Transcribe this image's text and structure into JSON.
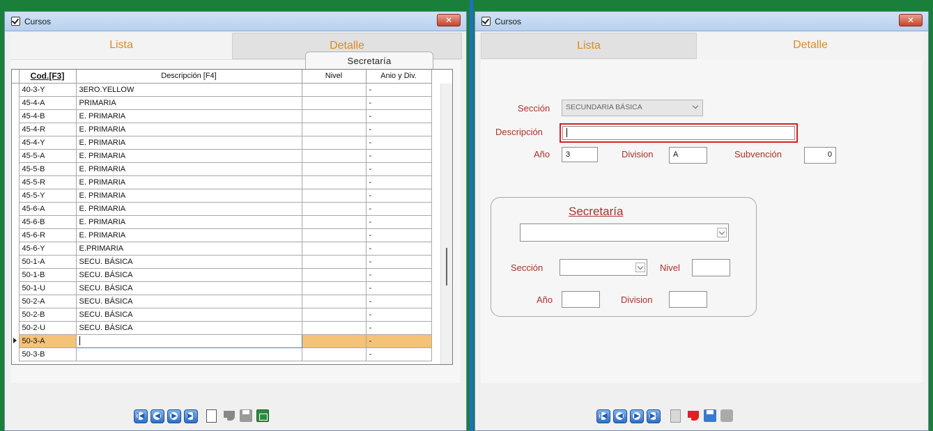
{
  "left_window": {
    "title": "Cursos",
    "close": "✕",
    "tabs": {
      "lista": "Lista",
      "detalle": "Detalle"
    },
    "section_tab": "Secretaría",
    "columns": [
      "Cod.[F3]",
      "Descripción [F4]",
      "Nivel",
      "Anio y Div."
    ],
    "rows": [
      [
        "40-3-Y",
        "3ERO.YELLOW",
        "",
        "-"
      ],
      [
        "45-4-A",
        "PRIMARIA",
        "",
        "-"
      ],
      [
        "45-4-B",
        "E. PRIMARIA",
        "",
        "-"
      ],
      [
        "45-4-R",
        "E. PRIMARIA",
        "",
        "-"
      ],
      [
        "45-4-Y",
        "E. PRIMARIA",
        "",
        "-"
      ],
      [
        "45-5-A",
        "E. PRIMARIA",
        "",
        "-"
      ],
      [
        "45-5-B",
        "E. PRIMARIA",
        "",
        "-"
      ],
      [
        "45-5-R",
        "E. PRIMARIA",
        "",
        "-"
      ],
      [
        "45-5-Y",
        "E. PRIMARIA",
        "",
        "-"
      ],
      [
        "45-6-A",
        "E. PRIMARIA",
        "",
        "-"
      ],
      [
        "45-6-B",
        "E. PRIMARIA",
        "",
        "-"
      ],
      [
        "45-6-R",
        "E. PRIMARIA",
        "",
        "-"
      ],
      [
        "45-6-Y",
        "E.PRIMARIA",
        "",
        "-"
      ],
      [
        "50-1-A",
        "SECU. BÁSICA",
        "",
        "-"
      ],
      [
        "50-1-B",
        "SECU. BÁSICA",
        "",
        "-"
      ],
      [
        "50-1-U",
        "SECU. BÁSICA",
        "",
        "-"
      ],
      [
        "50-2-A",
        "SECU. BÁSICA",
        "",
        "-"
      ],
      [
        "50-2-B",
        "SECU. BÁSICA",
        "",
        "-"
      ],
      [
        "50-2-U",
        "SECU. BÁSICA",
        "",
        "-"
      ],
      [
        "50-3-A",
        "",
        "",
        "-"
      ],
      [
        "50-3-B",
        "",
        "",
        "-"
      ]
    ],
    "selected_row": 19
  },
  "right_window": {
    "title": "Cursos",
    "close": "✕",
    "tabs": {
      "lista": "Lista",
      "detalle": "Detalle"
    },
    "form": {
      "seccion_label": "Sección",
      "seccion_value": "SECUNDARIA BÁSICA",
      "descripcion_label": "Descripción",
      "descripcion_value": "",
      "anio_label": "Año",
      "anio_value": "3",
      "division_label": "Division",
      "division_value": "A",
      "subvencion_label": "Subvención",
      "subvencion_value": "0"
    },
    "secretaria": {
      "title": "Secretaría",
      "select_value": "",
      "seccion_label": "Sección",
      "seccion_value": "",
      "nivel_label": "Nivel",
      "nivel_value": "",
      "anio_label": "Año",
      "anio_value": "",
      "division_label": "Division",
      "division_value": ""
    }
  },
  "colors": {
    "background": "#1a7f3a",
    "divider": "#1e6fc8",
    "tab_text": "#e08a1e",
    "label_text": "#a8322b",
    "selected_row": "#f5c278",
    "highlight_border": "#e0191e"
  },
  "toolbar_icons": [
    "first-record-icon",
    "previous-record-icon",
    "next-record-icon",
    "last-record-icon",
    "new-document-icon",
    "thumbs-down-icon",
    "save-icon",
    "delete-icon"
  ]
}
